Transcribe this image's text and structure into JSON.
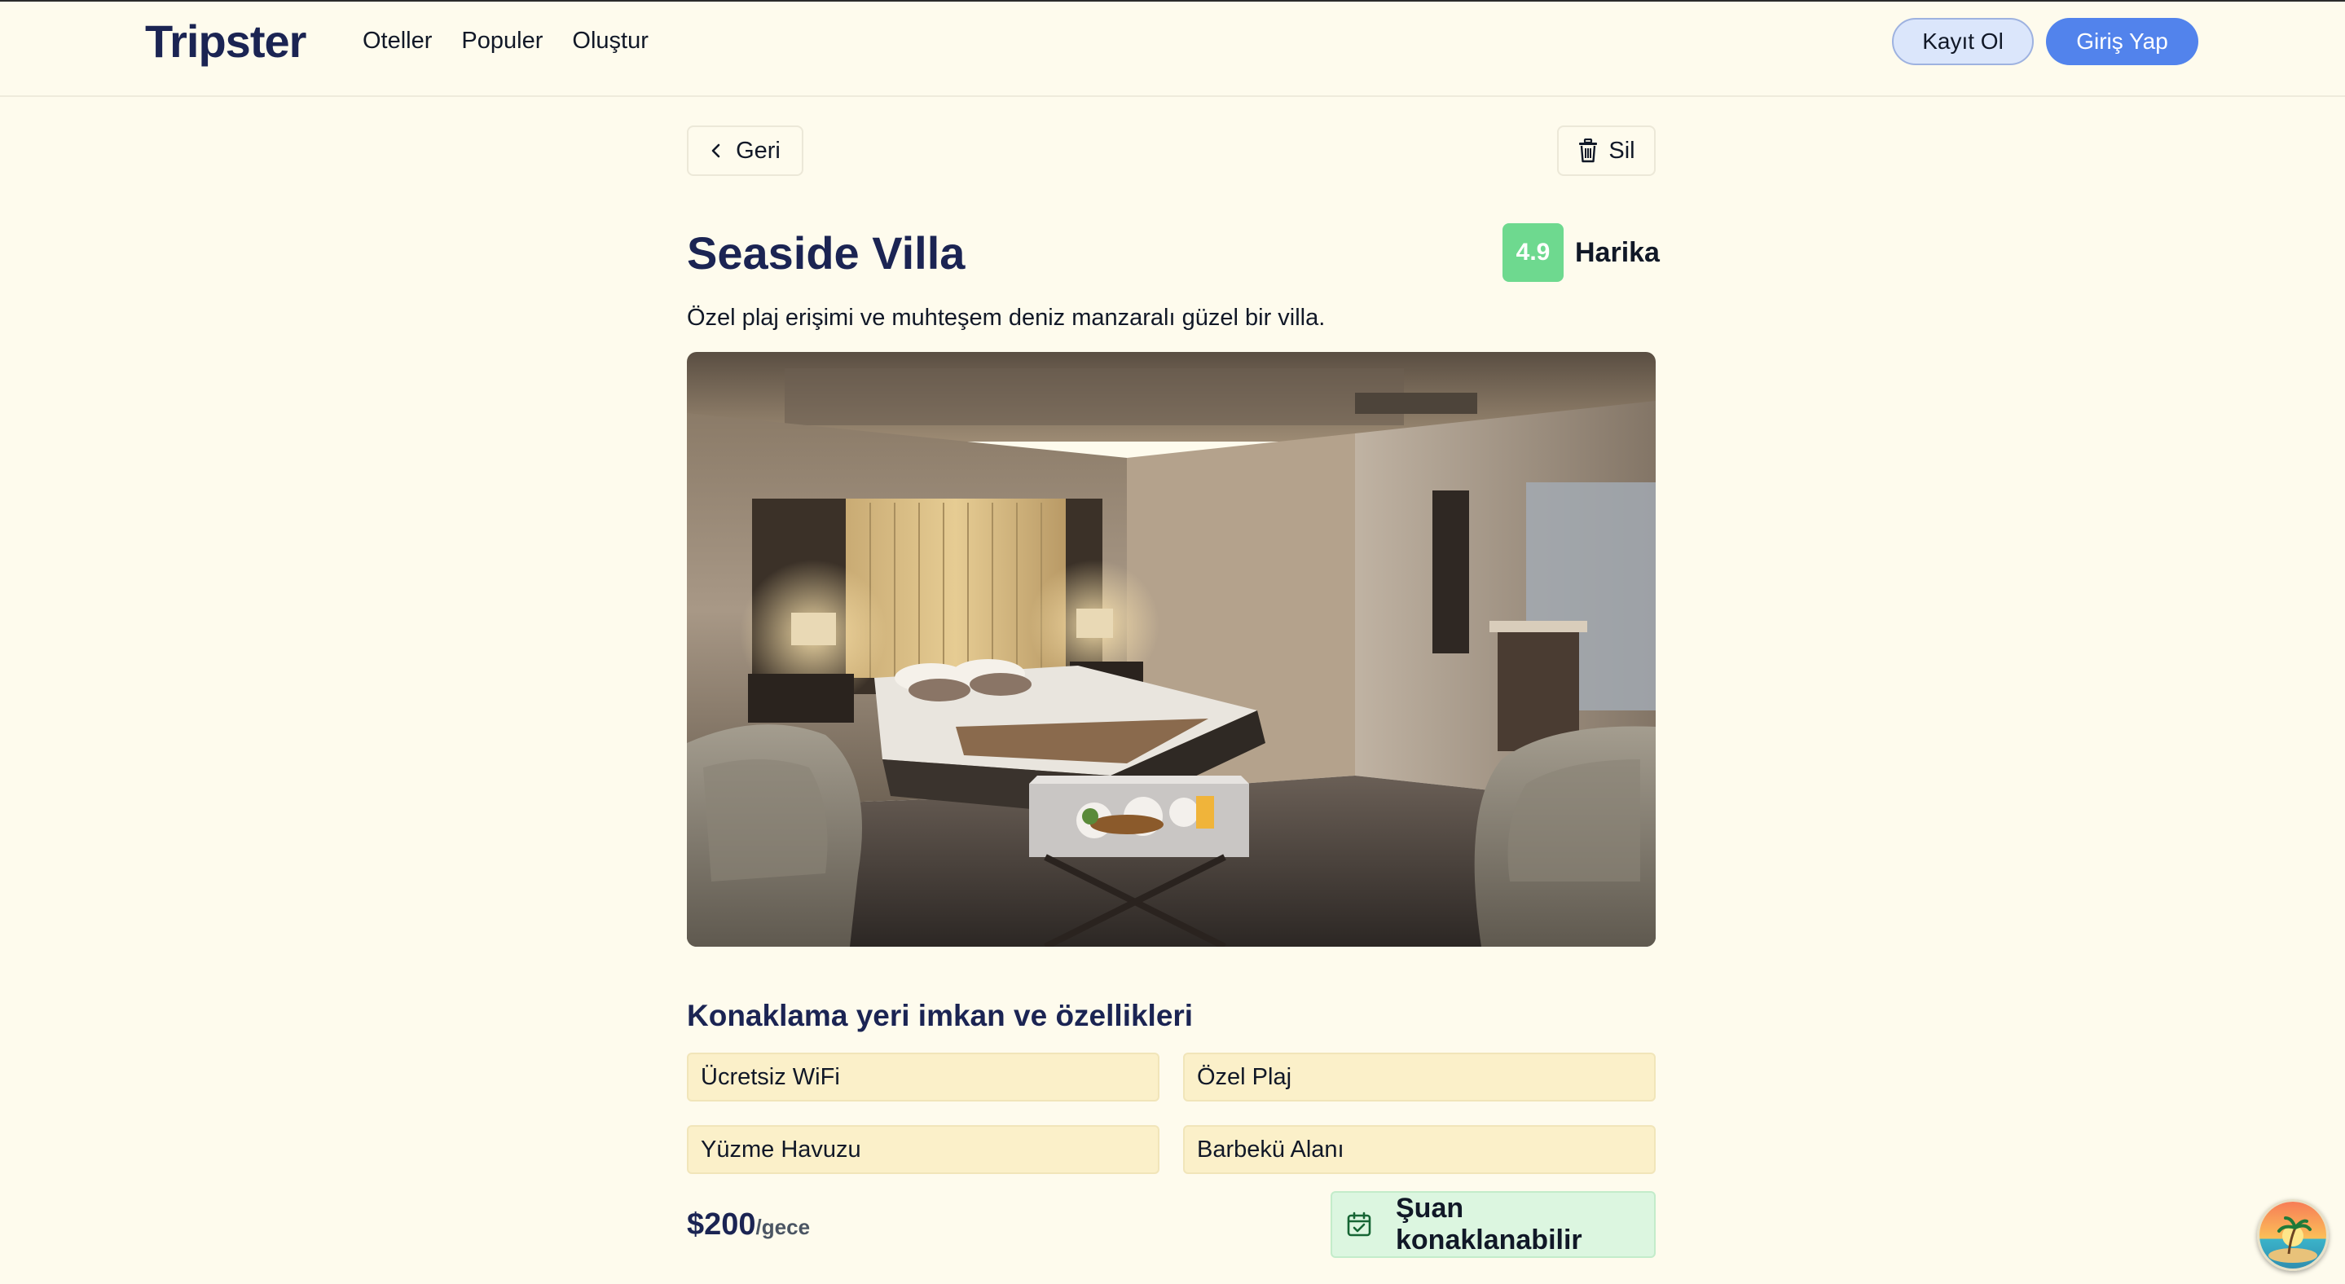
{
  "header": {
    "logo": "Tripster",
    "nav": [
      {
        "label": "Oteller"
      },
      {
        "label": "Populer"
      },
      {
        "label": "Oluştur"
      }
    ],
    "register_label": "Kayıt Ol",
    "login_label": "Giriş Yap"
  },
  "toolbar": {
    "back_label": "Geri",
    "back_icon": "chevron-left-icon",
    "delete_label": "Sil",
    "delete_icon": "trash-icon"
  },
  "hotel": {
    "name": "Seaside Villa",
    "rating": "4.9",
    "rating_label": "Harika",
    "description": "Özel plaj erişimi ve muhteşem deniz manzaralı güzel bir villa.",
    "image_subject": "hotel bedroom with bed, armchairs and breakfast tray"
  },
  "amenities": {
    "title": "Konaklama yeri imkan ve özellikleri",
    "items": [
      "Ücretsiz WiFi",
      "Özel Plaj",
      "Yüzme Havuzu",
      "Barbekü Alanı"
    ]
  },
  "pricing": {
    "amount": "$200",
    "unit": "/gece",
    "availability_label": "Şuan konaklanabilir",
    "availability_icon": "calendar-check-icon"
  },
  "colors": {
    "background": "#fefbed",
    "primary": "#5283ec",
    "heading": "#1b2453",
    "rating_badge": "#6ed98f",
    "amenity_bg": "#fbf0c9",
    "availability_bg": "#dcf6e0"
  }
}
